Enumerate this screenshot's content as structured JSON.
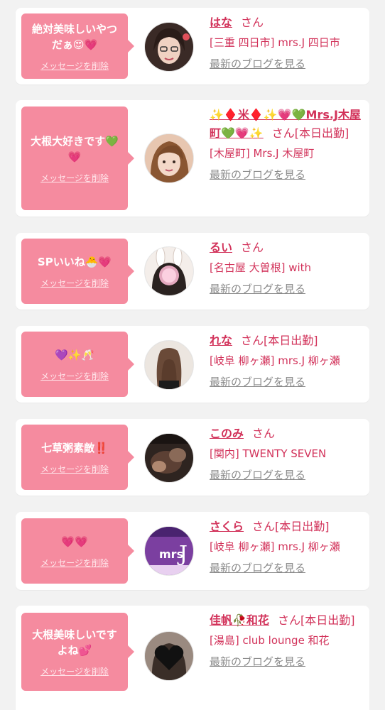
{
  "messages": [
    {
      "bubble_text": "絶対美味しいやつだぁ😍💗",
      "delete_label": "メッセージを削除",
      "name": "はな",
      "san": "さん",
      "status": "",
      "store": "[三重 四日市] mrs.J 四日市",
      "blog_label": "最新のブログを見る",
      "avatar": "woman-glasses-avatar"
    },
    {
      "bubble_text": "大根大好きです💚💗",
      "delete_label": "メッセージを削除",
      "name": "✨♦️米♦️✨💗💚Mrs.J木屋町💚💗✨",
      "san": "さん",
      "status": "[本日出勤]",
      "store": "[木屋町] Mrs.J 木屋町",
      "blog_label": "最新のブログを見る",
      "avatar": "woman-brown-hair-avatar"
    },
    {
      "bubble_text": "SPいいね🐣💗",
      "delete_label": "メッセージを削除",
      "name": "るい",
      "san": "さん",
      "status": "",
      "store": "[名古屋 大曽根] with",
      "blog_label": "最新のブログを見る",
      "avatar": "bunny-ears-avatar"
    },
    {
      "bubble_text": "💜✨🥂",
      "delete_label": "メッセージを削除",
      "name": "れな",
      "san": "さん",
      "status": "[本日出勤]",
      "store": "[岐阜 柳ヶ瀬] mrs.J 柳ヶ瀬",
      "blog_label": "最新のブログを見る",
      "avatar": "long-hair-back-avatar"
    },
    {
      "bubble_text": "七草粥素敵‼️",
      "delete_label": "メッセージを削除",
      "name": "このみ",
      "san": "さん",
      "status": "",
      "store": "[関内] TWENTY SEVEN",
      "blog_label": "最新のブログを見る",
      "avatar": "dark-photo-avatar"
    },
    {
      "bubble_text": "💗💗",
      "delete_label": "メッセージを削除",
      "name": "さくら",
      "san": "さん",
      "status": "[本日出勤]",
      "store": "[岐阜 柳ヶ瀬] mrs.J 柳ヶ瀬",
      "blog_label": "最新のブログを見る",
      "avatar": "mrsj-logo-avatar",
      "avatar_logo_text": "mrs.J"
    },
    {
      "bubble_text": "大根美味しいですよね💕",
      "delete_label": "メッセージを削除",
      "name": "佳帆🥀和花",
      "san": "さん",
      "status": "[本日出勤]",
      "store": "[湯島] club lounge 和花",
      "blog_label": "最新のブログを見る",
      "avatar": "black-heart-avatar"
    }
  ],
  "colors": {
    "accent": "#d2325a",
    "bubble": "#f58b9f",
    "background": "#f2f2f2",
    "link_gray": "#8a8a8a"
  }
}
